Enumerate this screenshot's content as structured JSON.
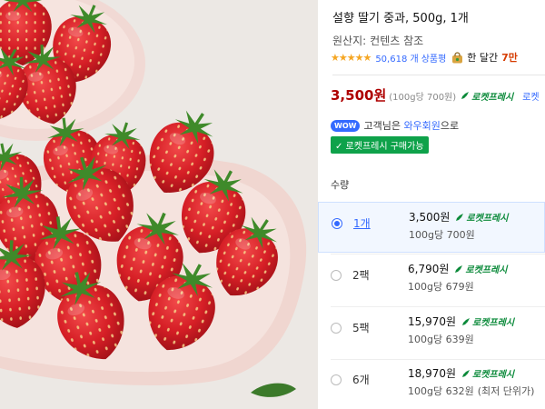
{
  "product": {
    "title": "설향 딸기 중과, 500g, 1개",
    "origin_label": "원산지:",
    "origin_value": "컨텐츠 참조",
    "rating_stars": "★★★★★",
    "review_count": "50,618 개",
    "review_label": "상품평",
    "recent_label": "한 달간",
    "recent_count": "7만",
    "price": "3,500원",
    "unit_price": "(100g당 700원)",
    "rocket_label": "로켓프레시",
    "rocket_label_2": "로켓"
  },
  "wow": {
    "badge": "WOW",
    "text_before": "고객님은",
    "member_text": "와우회원",
    "text_after": "으로",
    "fresh_buy": "✓ 로켓프레시 구매가능"
  },
  "options": {
    "quantity_label": "수량",
    "items": [
      {
        "label": "1개",
        "price": "3,500원",
        "rocket": "로켓프레시",
        "unit": "100g당 700원",
        "note": "",
        "selected": true
      },
      {
        "label": "2팩",
        "price": "6,790원",
        "rocket": "로켓프레시",
        "unit": "100g당 679원",
        "note": "",
        "selected": false
      },
      {
        "label": "5팩",
        "price": "15,970원",
        "rocket": "로켓프레시",
        "unit": "100g당 639원",
        "note": "",
        "selected": false
      },
      {
        "label": "6개",
        "price": "18,970원",
        "rocket": "로켓프레시",
        "unit": "100g당 632원",
        "note": "(최저 단위가)",
        "selected": false
      }
    ]
  },
  "colors": {
    "price_red": "#ae0000",
    "link_blue": "#346aff",
    "rocket_green": "#0b8a3a",
    "fresh_green": "#0ea24a",
    "star_yellow": "#f5a623"
  }
}
